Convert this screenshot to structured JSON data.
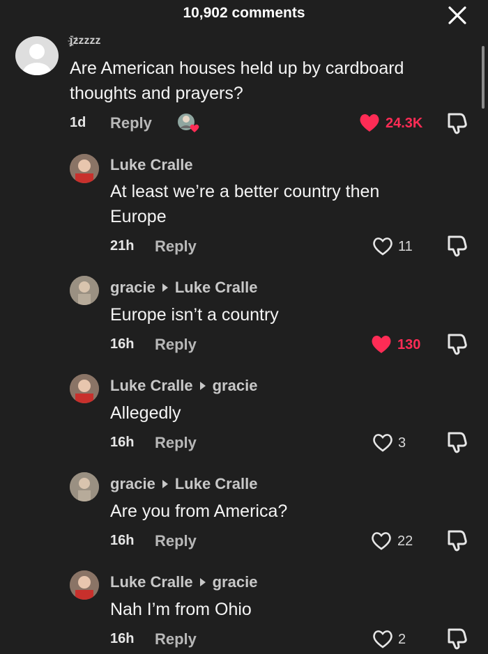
{
  "header": {
    "title": "10,902 comments",
    "close_icon": "close-icon"
  },
  "comments": [
    {
      "author": "j҉zzzzz",
      "mention": "",
      "text": "Are American houses held up by cardboard thoughts and prayers?",
      "time": "1d",
      "reply_label": "Reply",
      "likes": "24.3K",
      "liked": true,
      "creator_liked": true
    },
    {
      "author": "Luke Cralle",
      "mention": "",
      "text": "At least we’re a better country then Europe",
      "time": "21h",
      "reply_label": "Reply",
      "likes": "11",
      "liked": false
    },
    {
      "author": "gracie",
      "mention": "Luke Cralle",
      "text": "Europe isn’t a country",
      "time": "16h",
      "reply_label": "Reply",
      "likes": "130",
      "liked": true
    },
    {
      "author": "Luke Cralle",
      "mention": "gracie",
      "text": "Allegedly",
      "time": "16h",
      "reply_label": "Reply",
      "likes": "3",
      "liked": false
    },
    {
      "author": "gracie",
      "mention": "Luke Cralle",
      "text": "Are you from America?",
      "time": "16h",
      "reply_label": "Reply",
      "likes": "22",
      "liked": false
    },
    {
      "author": "Luke Cralle",
      "mention": "gracie",
      "text": "Nah I’m from Ohio",
      "time": "16h",
      "reply_label": "Reply",
      "likes": "2",
      "liked": false
    }
  ],
  "colors": {
    "like_active": "#fe2c55",
    "background": "#1f1f1f"
  }
}
